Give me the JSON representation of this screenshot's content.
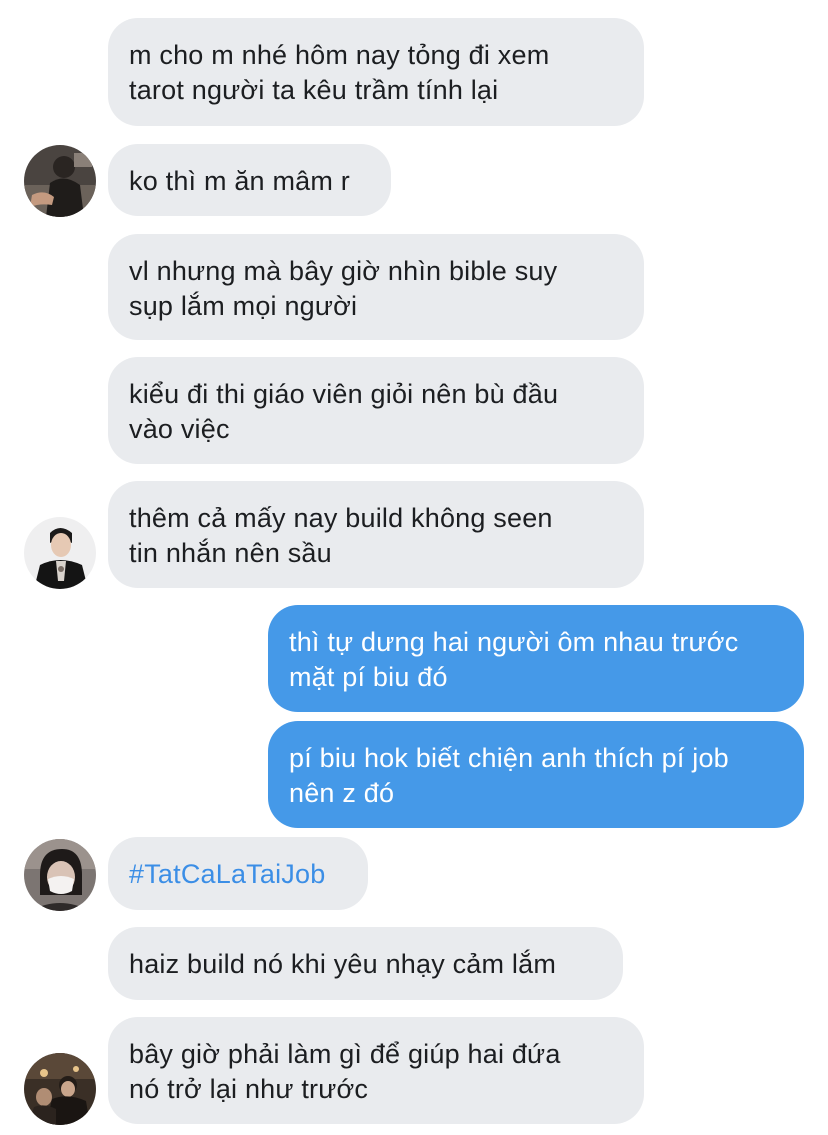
{
  "messages": [
    {
      "id": "m1",
      "from": "them",
      "text": "m cho m nhé hôm nay tỏng đi xem\ntarot người ta kêu trầm tính lại"
    },
    {
      "id": "m2",
      "from": "them",
      "text": "ko thì m ăn mâm r",
      "avatar": "avatar-man-tattoo"
    },
    {
      "id": "m3",
      "from": "them",
      "text": "vl nhưng mà bây giờ nhìn bible suy\nsụp lắm mọi người"
    },
    {
      "id": "m4",
      "from": "them",
      "text": "kiểu đi thi giáo viên giỏi nên bù đầu\nvào việc"
    },
    {
      "id": "m5",
      "from": "them",
      "text": "thêm cả mấy nay build không seen\ntin nhắn nên sầu",
      "avatar": "avatar-man-suit"
    },
    {
      "id": "m6",
      "from": "me",
      "text": "thì tự dưng hai người ôm nhau trước\nmặt pí biu đó"
    },
    {
      "id": "m7",
      "from": "me",
      "text": "pí biu hok biết chiện anh thích pí job\nnên z đó"
    },
    {
      "id": "m8",
      "from": "them",
      "text": "#TatCaLaTaiJob",
      "hashtag": true,
      "avatar": "avatar-person-mask"
    },
    {
      "id": "m9",
      "from": "them",
      "text": "haiz build nó khi yêu nhạy cảm lắm"
    },
    {
      "id": "m10",
      "from": "them",
      "text": "bây giờ phải làm gì để giúp hai đứa\nnó trở lại như trước",
      "avatar": "avatar-group-photo"
    }
  ],
  "colors": {
    "incoming_bubble": "#e9ebee",
    "outgoing_bubble": "#4599e8",
    "hashtag": "#3b8ee6",
    "text_dark": "#1c1e21",
    "text_light": "#ffffff"
  }
}
